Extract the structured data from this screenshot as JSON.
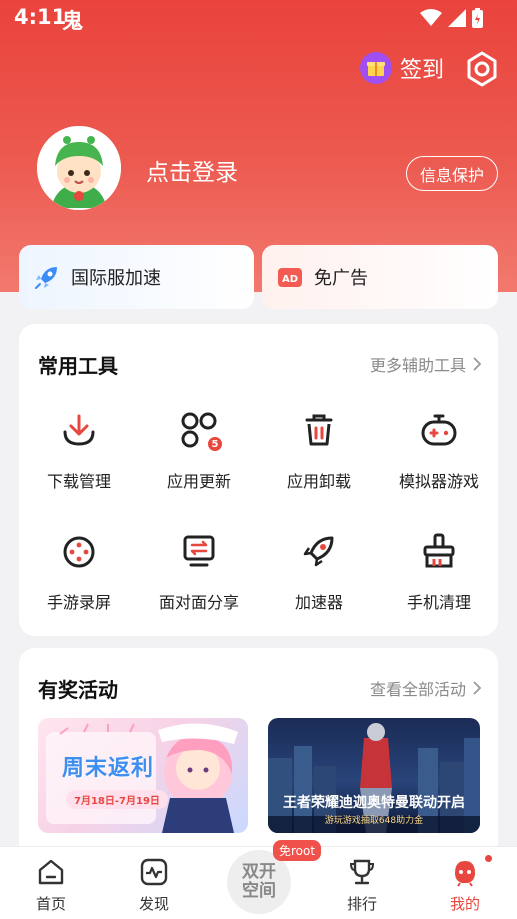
{
  "status_bar": {
    "time": "4:11",
    "carrier_icon": "鬼"
  },
  "header": {
    "checkin_label": "签到",
    "login_label": "点击登录",
    "privacy_label": "信息保护"
  },
  "quick_actions": [
    {
      "label": "国际服加速",
      "icon": "rocket-icon"
    },
    {
      "label": "免广告",
      "icon": "ad-free-icon"
    }
  ],
  "tools_section": {
    "title": "常用工具",
    "more_label": "更多辅助工具",
    "items": [
      {
        "label": "下载管理",
        "icon": "download-icon"
      },
      {
        "label": "应用更新",
        "icon": "app-update-icon",
        "badge": "5"
      },
      {
        "label": "应用卸载",
        "icon": "trash-icon"
      },
      {
        "label": "模拟器游戏",
        "icon": "gamepad-icon"
      },
      {
        "label": "手游录屏",
        "icon": "record-icon"
      },
      {
        "label": "面对面分享",
        "icon": "share-screen-icon"
      },
      {
        "label": "加速器",
        "icon": "accelerator-icon"
      },
      {
        "label": "手机清理",
        "icon": "cleaner-icon"
      }
    ]
  },
  "events_section": {
    "title": "有奖活动",
    "more_label": "查看全部活动",
    "banners": [
      {
        "title": "周末返利",
        "subtitle": "7月18日-7月19日"
      },
      {
        "title": "王者荣耀迪迦奥特曼联动开启",
        "subtitle": "游玩游戏抽取648助力金"
      }
    ]
  },
  "tab_bar": {
    "items": [
      {
        "label": "首页",
        "icon": "home-icon"
      },
      {
        "label": "发现",
        "icon": "discover-icon"
      },
      {
        "label": "排行",
        "icon": "trophy-icon"
      },
      {
        "label": "我的",
        "icon": "profile-icon",
        "active": true
      }
    ],
    "center": {
      "line1": "双开",
      "line2": "空间",
      "badge": "免root"
    }
  },
  "colors": {
    "accent": "#e8473f",
    "header_top": "#e9433c"
  }
}
